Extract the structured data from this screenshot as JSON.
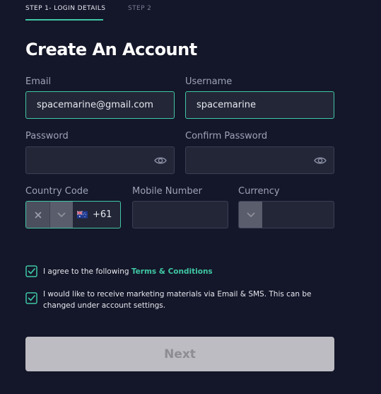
{
  "steps": {
    "step1": "STEP 1- LOGIN DETAILS",
    "step2": "STEP 2"
  },
  "title": "Create An Account",
  "form": {
    "email_label": "Email",
    "email_value": "spacemarine@gmail.com",
    "username_label": "Username",
    "username_value": "spacemarine",
    "password_label": "Password",
    "confirm_password_label": "Confirm Password",
    "country_code_label": "Country Code",
    "country_code_value": "+61",
    "mobile_label": "Mobile Number",
    "currency_label": "Currency"
  },
  "checkboxes": {
    "terms_prefix": "I agree to the following ",
    "terms_link": "Terms & Conditions",
    "marketing_text": "I would like to receive marketing materials via Email & SMS. This can be changed under account settings."
  },
  "next_label": "Next",
  "colors": {
    "background": "#141629",
    "accent": "#3fc7a4",
    "field_bg": "#232637",
    "button_disabled": "#bdbcc2"
  },
  "icons": [
    "eye-icon",
    "close-icon",
    "chevron-down-icon",
    "australia-flag-icon",
    "checkbox-checked-icon"
  ]
}
